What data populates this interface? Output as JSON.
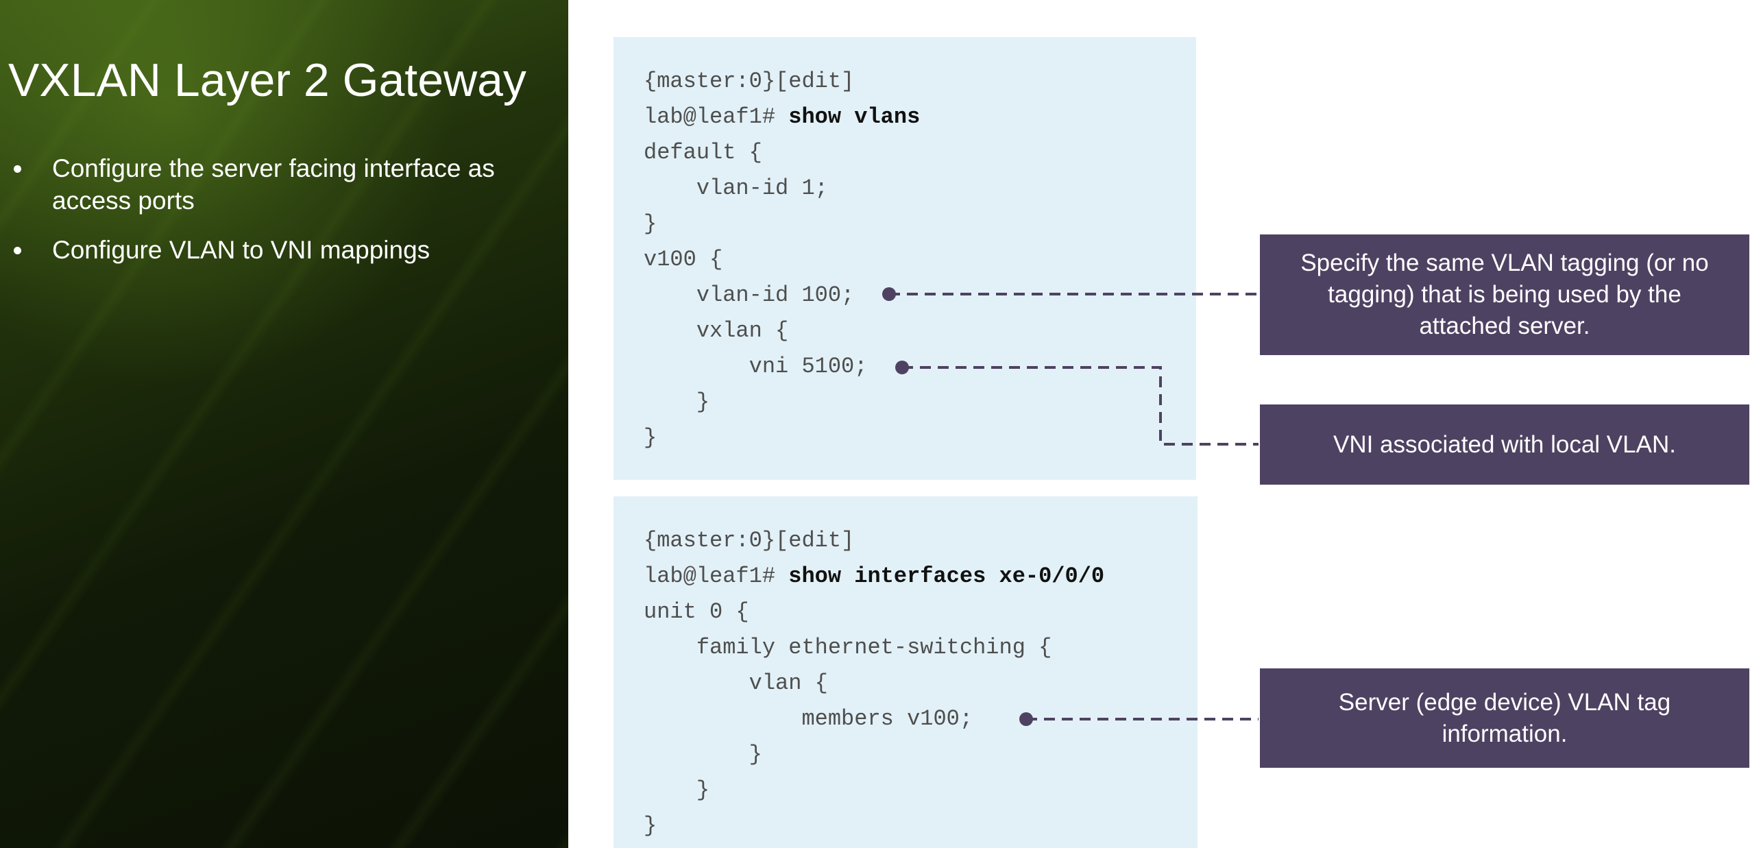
{
  "slide": {
    "title": "VXLAN Layer 2 Gateway",
    "bullets": [
      {
        "text": "Configure the server facing interface as access ports"
      },
      {
        "text": "Configure VLAN to VNI mappings"
      }
    ]
  },
  "code_vlans": {
    "lines": [
      {
        "text": "{master:0}[edit]"
      },
      {
        "prompt": "lab@leaf1# ",
        "command": "show vlans"
      },
      {
        "text": "default {"
      },
      {
        "text": "    vlan-id 1;"
      },
      {
        "text": "}"
      },
      {
        "text": "v100 {"
      },
      {
        "text": "    vlan-id 100;"
      },
      {
        "text": "    vxlan {"
      },
      {
        "text": "        vni 5100;"
      },
      {
        "text": "    }"
      },
      {
        "text": "}"
      }
    ]
  },
  "code_interfaces": {
    "lines": [
      {
        "text": "{master:0}[edit]"
      },
      {
        "prompt": "lab@leaf1# ",
        "command": "show interfaces xe-0/0/0"
      },
      {
        "text": "unit 0 {"
      },
      {
        "text": "    family ethernet-switching {"
      },
      {
        "text": "        vlan {"
      },
      {
        "text": "            members v100;"
      },
      {
        "text": "        }"
      },
      {
        "text": "    }"
      },
      {
        "text": "}"
      }
    ]
  },
  "callouts": {
    "vlan_tagging": "Specify the same VLAN tagging (or no tagging) that is being used by the attached server.",
    "vni": "VNI associated with local VLAN.",
    "server_tag": "Server (edge device) VLAN tag information."
  },
  "colors": {
    "callout_bg": "#4e4262",
    "code_panel_bg": "#e2f1f7",
    "leader_line": "#4e4262"
  }
}
